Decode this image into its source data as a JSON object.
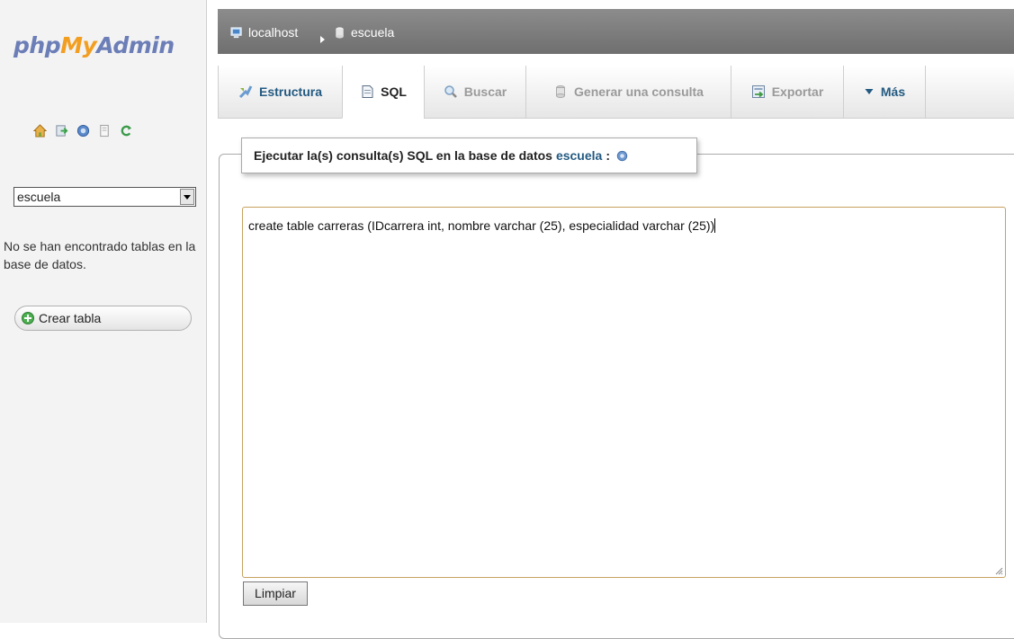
{
  "sidebar": {
    "logo": {
      "php": "php",
      "my": "My",
      "admin": "Admin"
    },
    "icons": [
      "home-icon",
      "logout-icon",
      "help-icon",
      "documentation-icon",
      "reload-icon"
    ],
    "db_select": {
      "value": "escuela"
    },
    "no_tables_text": "No se han encontrado tablas en la base de datos.",
    "create_table_label": "Crear tabla"
  },
  "breadcrumb": {
    "server": "localhost",
    "database": "escuela"
  },
  "tabs": [
    {
      "label": "Estructura",
      "state": "normal",
      "icon": "structure-icon"
    },
    {
      "label": "SQL",
      "state": "active",
      "icon": "sql-icon"
    },
    {
      "label": "Buscar",
      "state": "disabled",
      "icon": "search-icon"
    },
    {
      "label": "Generar una consulta",
      "state": "disabled",
      "icon": "query-icon"
    },
    {
      "label": "Exportar",
      "state": "disabled",
      "icon": "export-icon"
    },
    {
      "label": "Más",
      "state": "normal",
      "icon": "more-icon"
    }
  ],
  "query_section": {
    "legend_text": "Ejecutar la(s) consulta(s) SQL en la base de datos",
    "database": "escuela",
    "legend_colon": ":",
    "query_text": "create table carreras (IDcarrera int, nombre varchar (25), especialidad varchar (25))",
    "clear_label": "Limpiar"
  },
  "colors": {
    "link": "#235a81",
    "logo_blue": "#6c7eb7",
    "logo_orange": "#f29e21",
    "breadcrumb_bg": "#7d7d7d"
  }
}
